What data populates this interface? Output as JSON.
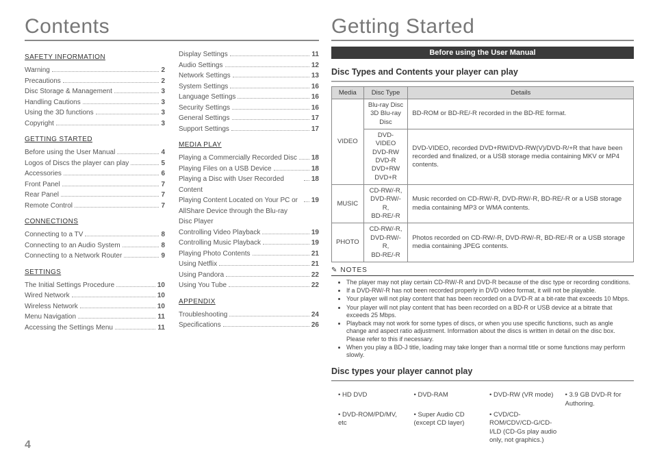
{
  "page_number": "4",
  "left": {
    "title": "Contents",
    "sections": [
      {
        "head": "SAFETY INFORMATION",
        "items": [
          {
            "label": "Warning",
            "page": "2"
          },
          {
            "label": "Precautions",
            "page": "2"
          },
          {
            "label": "Disc Storage & Management",
            "page": "3"
          },
          {
            "label": "Handling Cautions",
            "page": "3"
          },
          {
            "label": "Using the 3D functions",
            "page": "3"
          },
          {
            "label": "Copyright",
            "page": "3"
          }
        ]
      },
      {
        "head": "GETTING STARTED",
        "items": [
          {
            "label": "Before using the User Manual",
            "page": "4"
          },
          {
            "label": "Logos of Discs the player can play",
            "page": "5"
          },
          {
            "label": "Accessories",
            "page": "6"
          },
          {
            "label": "Front Panel",
            "page": "7"
          },
          {
            "label": "Rear Panel",
            "page": "7"
          },
          {
            "label": "Remote Control",
            "page": "7"
          }
        ]
      },
      {
        "head": "CONNECTIONS",
        "items": [
          {
            "label": "Connecting to a TV",
            "page": "8"
          },
          {
            "label": "Connecting to an Audio System",
            "page": "8"
          },
          {
            "label": "Connecting to a Network Router",
            "page": "9"
          }
        ]
      },
      {
        "head": "SETTINGS",
        "items": [
          {
            "label": "The Initial Settings Procedure",
            "page": "10"
          },
          {
            "label": "Wired Network",
            "page": "10"
          },
          {
            "label": "Wireless Network",
            "page": "10"
          },
          {
            "label": "Menu Navigation",
            "page": "11"
          },
          {
            "label": "Accessing the Settings Menu",
            "page": "11"
          }
        ]
      }
    ],
    "sections2": [
      {
        "head": "",
        "items": [
          {
            "label": "Display Settings",
            "page": "11"
          },
          {
            "label": "Audio Settings",
            "page": "12"
          },
          {
            "label": "Network Settings",
            "page": "13"
          },
          {
            "label": "System Settings",
            "page": "16"
          },
          {
            "label": "Language Settings",
            "page": "16"
          },
          {
            "label": "Security Settings",
            "page": "16"
          },
          {
            "label": "General Settings",
            "page": "17"
          },
          {
            "label": "Support Settings",
            "page": "17"
          }
        ]
      },
      {
        "head": "MEDIA PLAY",
        "items": [
          {
            "label": "Playing a Commercially Recorded Disc",
            "page": "18"
          },
          {
            "label": "Playing Files on a USB Device",
            "page": "18"
          },
          {
            "label": "Playing a Disc with User Recorded Content",
            "page": "18"
          },
          {
            "label": "Playing Content Located on Your PC or AllShare Device through the Blu-ray Disc Player",
            "page": "19"
          },
          {
            "label": "Controlling Video Playback",
            "page": "19"
          },
          {
            "label": "Controlling Music Playback",
            "page": "19"
          },
          {
            "label": "Playing Photo Contents",
            "page": "21"
          },
          {
            "label": "Using Netflix",
            "page": "21"
          },
          {
            "label": "Using Pandora",
            "page": "22"
          },
          {
            "label": "Using You Tube",
            "page": "22"
          }
        ]
      },
      {
        "head": "APPENDIX",
        "items": [
          {
            "label": "Troubleshooting",
            "page": "24"
          },
          {
            "label": "Specifications",
            "page": "26"
          }
        ]
      }
    ]
  },
  "right": {
    "title": "Getting Started",
    "banner": "Before using the User Manual",
    "sub1": "Disc Types and Contents your player can play",
    "table": {
      "headers": [
        "Media",
        "Disc Type",
        "Details"
      ],
      "rows": [
        {
          "media": "VIDEO",
          "types": "Blu-ray Disc\n3D Blu-ray Disc",
          "details": "BD-ROM or BD-RE/-R recorded in the BD-RE format.",
          "span": true
        },
        {
          "media": "",
          "types": "DVD-VIDEO\nDVD-RW\nDVD-R\nDVD+RW\nDVD+R",
          "details": "DVD-VIDEO, recorded DVD+RW/DVD-RW(V)/DVD-R/+R that have been recorded and finalized, or a USB storage media containing MKV or MP4 contents."
        },
        {
          "media": "MUSIC",
          "types": "CD-RW/-R,\nDVD-RW/-R,\nBD-RE/-R",
          "details": "Music recorded on CD-RW/-R, DVD-RW/-R, BD-RE/-R or a USB storage media containing MP3 or WMA contents."
        },
        {
          "media": "PHOTO",
          "types": "CD-RW/-R,\nDVD-RW/-R,\nBD-RE/-R",
          "details": "Photos recorded on CD-RW/-R, DVD-RW/-R, BD-RE/-R or a USB storage media containing JPEG contents."
        }
      ]
    },
    "notes_head": "NOTES",
    "notes": [
      "The player may not play certain CD-RW/-R and DVD-R because of the disc type or recording conditions.",
      "If a DVD-RW/-R has not been recorded properly in DVD video format, it will not be playable.",
      "Your player will not play content that has been recorded on a DVD-R at a bit-rate that exceeds 10 Mbps.",
      "Your player will not play content that has been recorded on a BD-R or USB device at a bitrate that exceeds 25 Mbps.",
      "Playback may not work for some types of discs, or when you use specific functions, such as angle change and aspect ratio adjustment. Information about the discs is written in detail on the disc box. Please refer to this if necessary.",
      "When you play a BD-J title, loading may take longer than a normal title or some functions may perform slowly."
    ],
    "sub2": "Disc types your player cannot play",
    "cannot": [
      "HD DVD",
      "DVD-RAM",
      "DVD-RW (VR mode)",
      "3.9 GB DVD-R for Authoring.",
      "DVD-ROM/PD/MV, etc",
      "Super Audio CD (except CD layer)",
      "CVD/CD-ROM/CDV/CD-G/CD-I/LD (CD-Gs play audio only, not graphics.)",
      ""
    ]
  }
}
